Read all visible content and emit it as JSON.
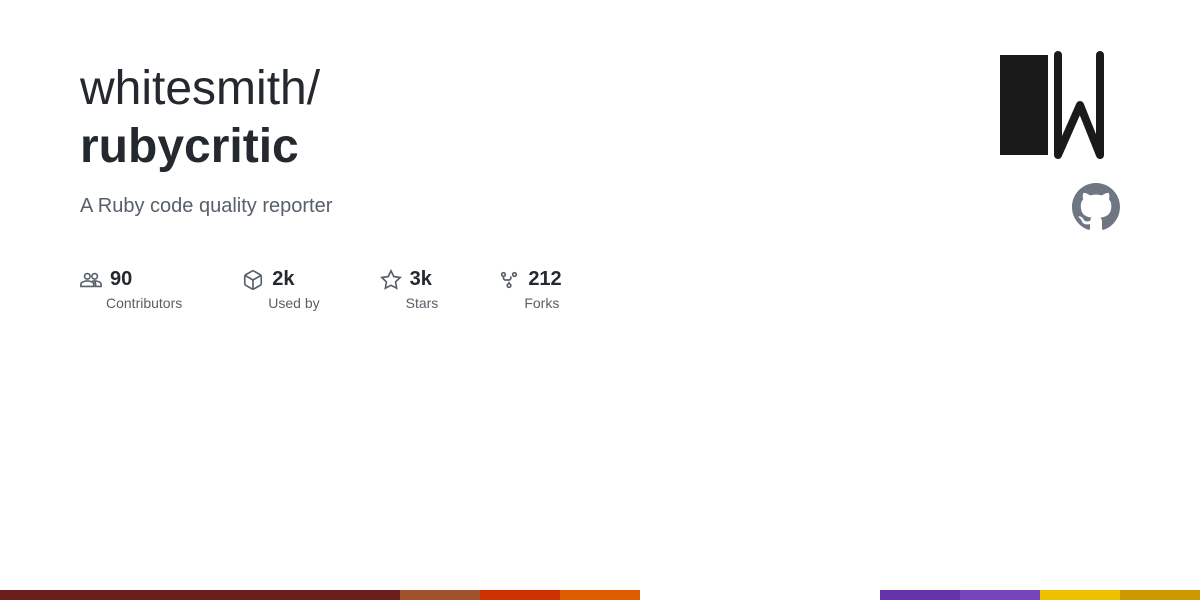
{
  "repo": {
    "owner": "whitesmith/",
    "name": "rubycritic",
    "description": "A Ruby code quality reporter"
  },
  "stats": [
    {
      "id": "contributors",
      "count": "90",
      "label": "Contributors",
      "icon": "contributors-icon"
    },
    {
      "id": "used-by",
      "count": "2k",
      "label": "Used by",
      "icon": "package-icon"
    },
    {
      "id": "stars",
      "count": "3k",
      "label": "Stars",
      "icon": "star-icon"
    },
    {
      "id": "forks",
      "count": "212",
      "label": "Forks",
      "icon": "fork-icon"
    }
  ],
  "bottom_bar": [
    {
      "color": "#6e1d1d",
      "flex": 5
    },
    {
      "color": "#a0522d",
      "flex": 1
    },
    {
      "color": "#cc3300",
      "flex": 1
    },
    {
      "color": "#e05c00",
      "flex": 1
    },
    {
      "color": "#ffffff",
      "flex": 3
    },
    {
      "color": "#6633aa",
      "flex": 1
    },
    {
      "color": "#7744bb",
      "flex": 1
    },
    {
      "color": "#f0c000",
      "flex": 1
    },
    {
      "color": "#cc9900",
      "flex": 1
    }
  ]
}
